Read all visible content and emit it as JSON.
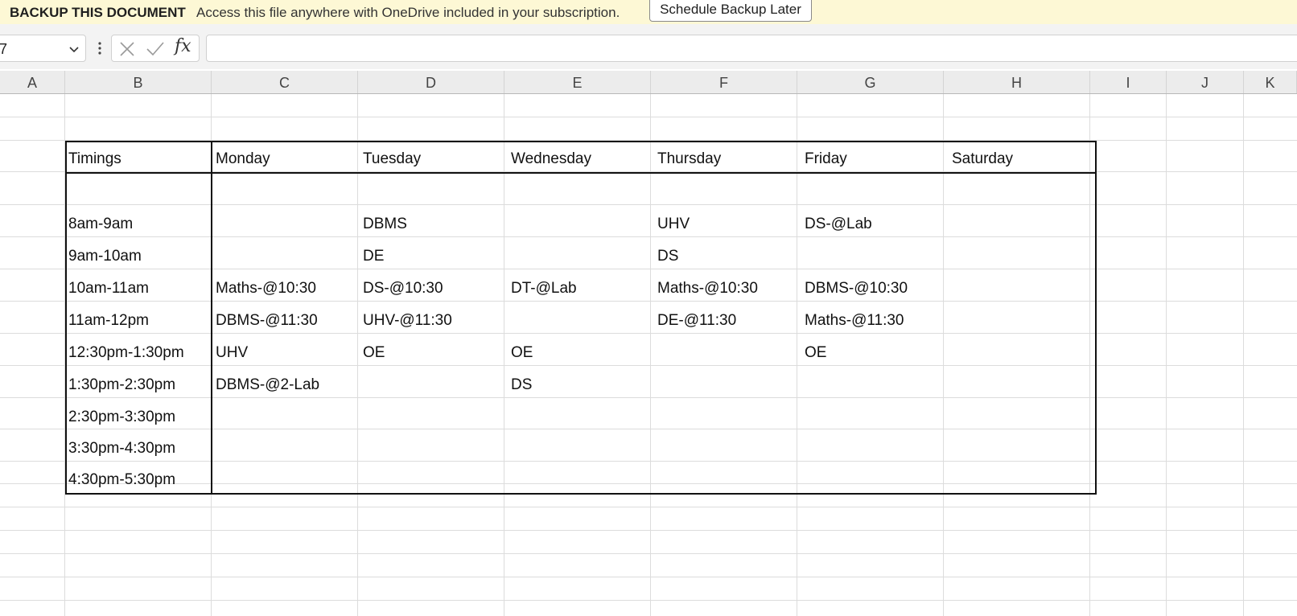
{
  "notification": {
    "title": "BACKUP THIS DOCUMENT",
    "message": "Access this file anywhere with OneDrive included in your subscription.",
    "button": "Schedule Backup Later"
  },
  "formula_bar": {
    "name_box": "7",
    "fx_label": "fx",
    "formula": ""
  },
  "columns": [
    "A",
    "B",
    "C",
    "D",
    "E",
    "F",
    "G",
    "H",
    "I",
    "J",
    "K"
  ],
  "timetable": {
    "headers": [
      "Timings",
      "Monday",
      "Tuesday",
      "Wednesday",
      "Thursday",
      "Friday",
      "Saturday"
    ],
    "rows": [
      [
        "",
        "",
        "",
        "",
        "",
        "",
        ""
      ],
      [
        "8am-9am",
        "",
        "DBMS",
        "",
        "UHV",
        "DS-@Lab",
        ""
      ],
      [
        "9am-10am",
        "",
        "DE",
        "",
        "DS",
        "",
        ""
      ],
      [
        "10am-11am",
        "Maths-@10:30",
        "DS-@10:30",
        "DT-@Lab",
        "Maths-@10:30",
        "DBMS-@10:30",
        ""
      ],
      [
        "11am-12pm",
        "DBMS-@11:30",
        "UHV-@11:30",
        "",
        "DE-@11:30",
        "Maths-@11:30",
        ""
      ],
      [
        "12:30pm-1:30pm",
        "UHV",
        "OE",
        "OE",
        "",
        "OE",
        ""
      ],
      [
        "1:30pm-2:30pm",
        "DBMS-@2-Lab",
        "",
        "DS",
        "",
        "",
        ""
      ],
      [
        "2:30pm-3:30pm",
        "",
        "",
        "",
        "",
        "",
        ""
      ],
      [
        "3:30pm-4:30pm",
        "",
        "",
        "",
        "",
        "",
        ""
      ],
      [
        "4:30pm-5:30pm",
        "",
        "",
        "",
        "",
        "",
        ""
      ]
    ]
  }
}
